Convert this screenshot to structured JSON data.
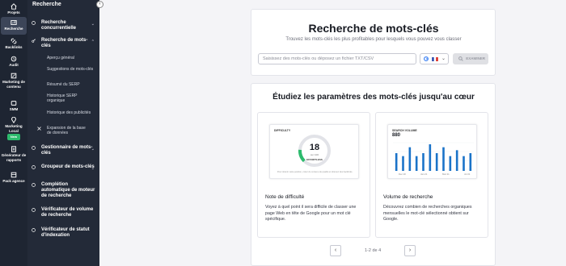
{
  "rail": {
    "items": [
      {
        "label": "Projets",
        "icon": "home-icon"
      },
      {
        "label": "Recherche",
        "icon": "research-icon"
      },
      {
        "label": "Backlinks",
        "icon": "link-icon"
      },
      {
        "label": "Audit",
        "icon": "audit-icon"
      },
      {
        "label": "Marketing de contenu",
        "icon": "content-icon"
      },
      {
        "label": "SMM",
        "icon": "smm-icon"
      },
      {
        "label": "Marketing Local",
        "icon": "location-icon"
      },
      {
        "label": "Générateur de rapports",
        "icon": "report-icon"
      },
      {
        "label": "Pack agence",
        "icon": "agency-icon"
      }
    ],
    "new_badge": "New"
  },
  "sidebar": {
    "title": "Recherche",
    "items": [
      {
        "label": "Recherche concurrentielle"
      },
      {
        "label": "Recherche de mots-clés"
      },
      {
        "label": "Gestionnaire de mots-clés"
      },
      {
        "label": "Groupeur de mots-clés"
      },
      {
        "label": "Complétion automatique de moteur de recherche"
      },
      {
        "label": "Vérificateur de volume de recherche"
      },
      {
        "label": "Vérificateur de statut d'indexation"
      }
    ],
    "subitems": [
      {
        "label": "Aperçu général"
      },
      {
        "label": "Suggestions de mots-clés"
      },
      {
        "label": "Résumé du SERP"
      },
      {
        "label": "Historique SERP organique"
      },
      {
        "label": "Historique des publicités"
      },
      {
        "label": "Expansion de la base de données"
      }
    ]
  },
  "main": {
    "title": "Recherche de mots-clés",
    "subtitle": "Trouvez les mots-clés les plus profitables pour lesquels vous pouvez vous classer",
    "search_placeholder": "Saisissez des mots-clés ou déposez un fichier TXT/CSV",
    "examine_label": "EXAMINER",
    "section_title": "Étudiez les paramètres des mots-clés jusqu'au cœur",
    "features": [
      {
        "title": "Note de difficulté",
        "desc": "Voyez à quel point il sera difficile de classer une page Web en tête de Google pour un mot clé spécifique.",
        "preview": {
          "label": "DIFFICULTY",
          "score": "18",
          "score_sub": "sur 100",
          "difficulty_label": "EFFORTLESS",
          "gauge_fraction": 0.18,
          "foot": "Pour obtenir cette position, créez du contenu de qualité et obtenez des backlinks."
        }
      },
      {
        "title": "Volume de recherche",
        "desc": "Découvrez combien de recherches organiques mensuelles le mot-clé sélectionné obtient sur Google.",
        "preview": {
          "label": "SEARCH VOLUME",
          "value": "880",
          "months": [
            "Dec 20",
            "Jan 21",
            "Mar 21",
            "Jul 21"
          ]
        }
      }
    ],
    "pagination": "1-2 de 4"
  },
  "chart_data": {
    "type": "bar",
    "values": [
      6,
      5,
      8,
      5,
      6,
      9,
      6,
      8,
      5,
      7,
      5,
      6
    ],
    "color": "#1a73c8",
    "green": "#2dbb6d"
  }
}
